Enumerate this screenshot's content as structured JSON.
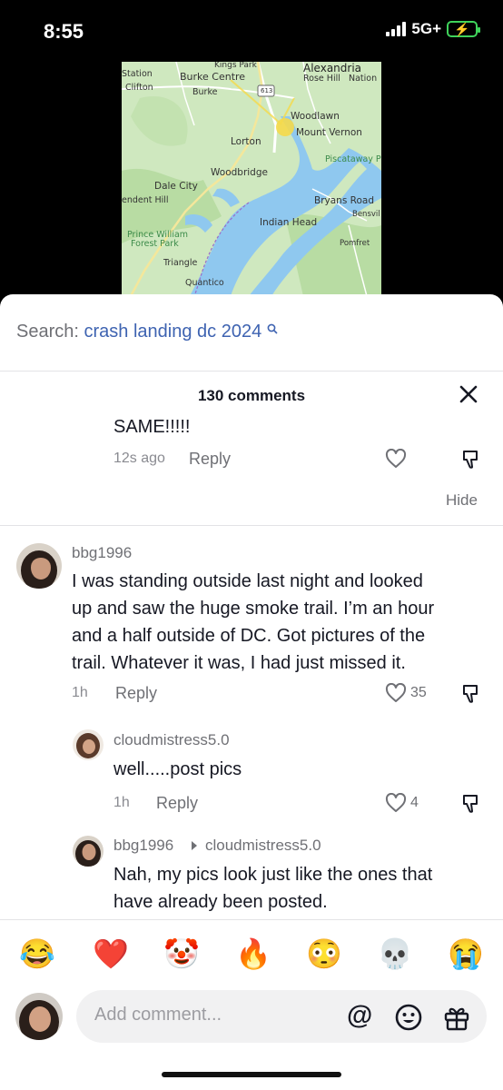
{
  "status_bar": {
    "time": "8:55",
    "network": "5G+",
    "battery_symbol": "⚡"
  },
  "map": {
    "labels": {
      "station": "Station",
      "clifton": "Clifton",
      "burke_centre": "Burke Centre",
      "burke": "Burke",
      "kings_park": "Kings Park",
      "route": "613",
      "alexandria": "Alexandria",
      "rose_hill": "Rose Hill",
      "nation": "Nation",
      "woodlawn": "Woodlawn",
      "mount_vernon": "Mount Vernon",
      "lorton": "Lorton",
      "piscataway": "Piscataway P",
      "woodbridge": "Woodbridge",
      "dale_city": "Dale City",
      "endent_hill": "endent Hill",
      "bryans_road": "Bryans Road",
      "bensvil": "Bensvil",
      "indian_head": "Indian Head",
      "prince_william": "Prince William",
      "forest_park": "Forest Park",
      "pomfret": "Pomfret",
      "triangle": "Triangle",
      "quantico": "Quantico"
    },
    "colors": {
      "land": "#cfe8bf",
      "water": "#8fc8ef",
      "road": "#ffffff",
      "highlight": "#f5d94a"
    }
  },
  "search": {
    "prefix": "Search:",
    "query": "crash landing dc 2024"
  },
  "comments_header": {
    "title": "130 comments"
  },
  "comments": [
    {
      "text": "SAME!!!!!",
      "time": "12s ago",
      "reply_label": "Reply",
      "likes": "",
      "hide_label": "Hide"
    },
    {
      "username": "bbg1996",
      "lines": [
        "I was standing outside last night and looked",
        "up and saw the huge smoke trail. I’m an hour",
        "and a half outside of DC. Got pictures of the",
        "trail. Whatever it was, I had just missed it."
      ],
      "time": "1h",
      "reply_label": "Reply",
      "likes": "35"
    },
    {
      "username": "cloudmistress5.0",
      "text": "well.....post pics",
      "time": "1h",
      "reply_label": "Reply",
      "likes": "4"
    },
    {
      "username": "bbg1996",
      "reply_to": "cloudmistress5.0",
      "lines": [
        "Nah, my pics look just like the ones that",
        "have already been posted."
      ]
    }
  ],
  "emoji_bar": [
    "😂",
    "❤️",
    "🤡",
    "🔥",
    "😳",
    "💀",
    "😭"
  ],
  "composer": {
    "placeholder": "Add comment...",
    "mention_symbol": "@"
  },
  "accent": "#3e63b1"
}
